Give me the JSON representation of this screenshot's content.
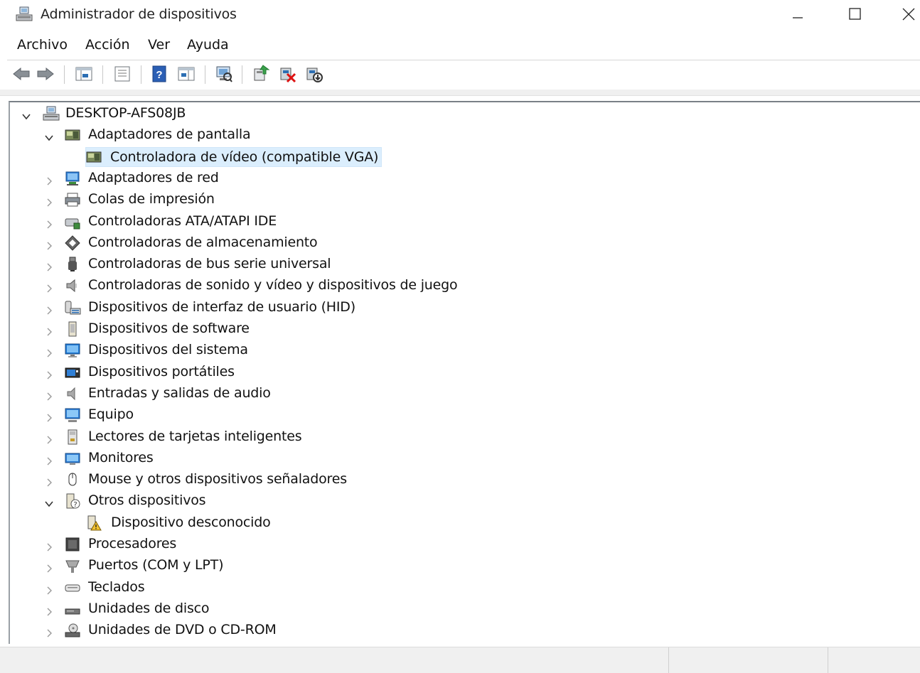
{
  "window": {
    "title": "Administrador de dispositivos"
  },
  "menu": [
    "Archivo",
    "Acción",
    "Ver",
    "Ayuda"
  ],
  "toolbar": {
    "buttons": [
      "back-arrow-icon",
      "forward-arrow-icon",
      "show-hide-console-tree-icon",
      "properties-icon",
      "help-icon",
      "action-pane-icon",
      "scan-hardware-icon",
      "update-driver-icon",
      "uninstall-device-icon",
      "disable-device-icon"
    ]
  },
  "tree": {
    "root": "DESKTOP-AFS08JB",
    "categories": [
      {
        "label": "Adaptadores de pantalla",
        "expanded": true,
        "children": [
          "Controladora de vídeo (compatible VGA)"
        ]
      },
      {
        "label": "Adaptadores de red",
        "expanded": false
      },
      {
        "label": "Colas de impresión",
        "expanded": false
      },
      {
        "label": "Controladoras ATA/ATAPI IDE",
        "expanded": false
      },
      {
        "label": "Controladoras de almacenamiento",
        "expanded": false
      },
      {
        "label": "Controladoras de bus serie universal",
        "expanded": false
      },
      {
        "label": "Controladoras de sonido y vídeo y dispositivos de juego",
        "expanded": false
      },
      {
        "label": "Dispositivos de interfaz de usuario (HID)",
        "expanded": false
      },
      {
        "label": "Dispositivos de software",
        "expanded": false
      },
      {
        "label": "Dispositivos del sistema",
        "expanded": false
      },
      {
        "label": "Dispositivos portátiles",
        "expanded": false
      },
      {
        "label": "Entradas y salidas de audio",
        "expanded": false
      },
      {
        "label": "Equipo",
        "expanded": false
      },
      {
        "label": "Lectores de tarjetas inteligentes",
        "expanded": false
      },
      {
        "label": "Monitores",
        "expanded": false
      },
      {
        "label": "Mouse y otros dispositivos señaladores",
        "expanded": false
      },
      {
        "label": "Otros dispositivos",
        "expanded": true,
        "children": [
          "Dispositivo desconocido"
        ]
      },
      {
        "label": "Procesadores",
        "expanded": false
      },
      {
        "label": "Puertos (COM y LPT)",
        "expanded": false
      },
      {
        "label": "Teclados",
        "expanded": false
      },
      {
        "label": "Unidades de disco",
        "expanded": false
      },
      {
        "label": "Unidades de DVD o CD-ROM",
        "expanded": false
      }
    ],
    "selected": "Controladora de vídeo (compatible VGA)"
  },
  "colors": {
    "selection": "#dbeefd",
    "border": "#7a8087",
    "statusbar": "#f0f0f0"
  }
}
